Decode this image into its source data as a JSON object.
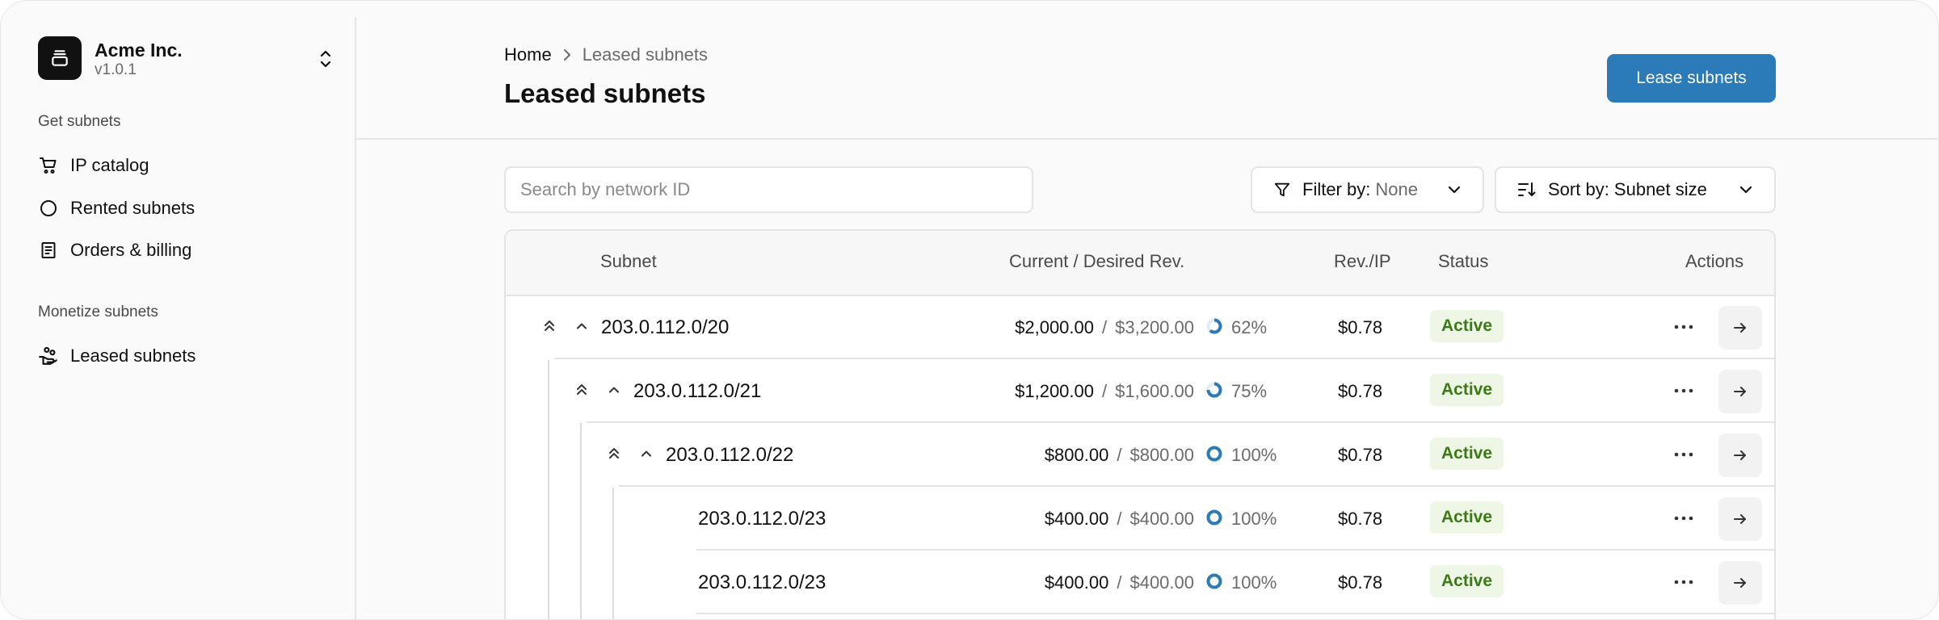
{
  "sidebar": {
    "org_name": "Acme Inc.",
    "org_version": "v1.0.1",
    "sections": [
      {
        "title": "Get subnets",
        "items": [
          {
            "label": "IP catalog",
            "icon": "cart-icon"
          },
          {
            "label": "Rented subnets",
            "icon": "circle-icon"
          },
          {
            "label": "Orders & billing",
            "icon": "receipt-icon"
          }
        ]
      },
      {
        "title": "Monetize subnets",
        "items": [
          {
            "label": "Leased subnets",
            "icon": "hand-coins-icon"
          }
        ]
      }
    ]
  },
  "header": {
    "breadcrumb": [
      "Home",
      "Leased subnets"
    ],
    "title": "Leased subnets",
    "primary_action": "Lease subnets"
  },
  "toolbar": {
    "search_placeholder": "Search by network ID",
    "filter_label": "Filter by:",
    "filter_value": "None",
    "sort_label": "Sort by: Subnet size"
  },
  "table": {
    "columns": [
      "Subnet",
      "Current / Desired Rev.",
      "Rev./IP",
      "Status",
      "Actions"
    ],
    "rows": [
      {
        "subnet": "203.0.112.0/20",
        "current": "$2,000.00",
        "desired": "$3,200.00",
        "percent": "62%",
        "fill": 0.62,
        "rev_ip": "$0.78",
        "status": "Active",
        "depth": 0,
        "expandable": true
      },
      {
        "subnet": "203.0.112.0/21",
        "current": "$1,200.00",
        "desired": "$1,600.00",
        "percent": "75%",
        "fill": 0.75,
        "rev_ip": "$0.78",
        "status": "Active",
        "depth": 1,
        "expandable": true
      },
      {
        "subnet": "203.0.112.0/22",
        "current": "$800.00",
        "desired": "$800.00",
        "percent": "100%",
        "fill": 1.0,
        "rev_ip": "$0.78",
        "status": "Active",
        "depth": 2,
        "expandable": true
      },
      {
        "subnet": "203.0.112.0/23",
        "current": "$400.00",
        "desired": "$400.00",
        "percent": "100%",
        "fill": 1.0,
        "rev_ip": "$0.78",
        "status": "Active",
        "depth": 3,
        "expandable": false
      },
      {
        "subnet": "203.0.112.0/23",
        "current": "$400.00",
        "desired": "$400.00",
        "percent": "100%",
        "fill": 1.0,
        "rev_ip": "$0.78",
        "status": "Active",
        "depth": 3,
        "expandable": false
      }
    ]
  },
  "colors": {
    "accent": "#2b7bb9",
    "status_active_bg": "#eef6e6",
    "status_active_text": "#3c7a16"
  }
}
